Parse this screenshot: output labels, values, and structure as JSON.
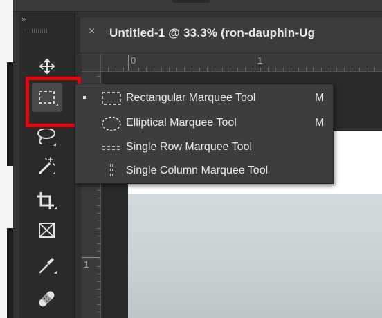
{
  "document": {
    "tab_title": "Untitled-1 @ 33.3% (ron-dauphin-Ug",
    "close_symbol": "×"
  },
  "toolbar": {
    "collapse_symbol": "››",
    "tools": [
      {
        "name": "move-tool",
        "icon": "move-icon"
      },
      {
        "name": "rectangular-marquee-tool",
        "icon": "rectangular-marquee-icon",
        "selected": true
      },
      {
        "name": "lasso-tool",
        "icon": "lasso-icon"
      },
      {
        "name": "magic-wand-tool",
        "icon": "magic-wand-icon"
      },
      {
        "name": "crop-tool",
        "icon": "crop-icon"
      },
      {
        "name": "frame-tool",
        "icon": "frame-icon"
      },
      {
        "name": "eyedropper-tool",
        "icon": "eyedropper-icon"
      },
      {
        "name": "healing-brush-tool",
        "icon": "bandage-icon"
      }
    ]
  },
  "rulers": {
    "top_labels": [
      "0",
      "1"
    ],
    "left_labels": [
      "1"
    ]
  },
  "flyout_menu": {
    "items": [
      {
        "label": "Rectangular Marquee Tool",
        "shortcut": "M",
        "icon": "rectangular-marquee-icon",
        "active": true
      },
      {
        "label": "Elliptical Marquee Tool",
        "shortcut": "M",
        "icon": "elliptical-marquee-icon",
        "active": false
      },
      {
        "label": "Single Row Marquee Tool",
        "shortcut": "",
        "icon": "single-row-marquee-icon",
        "active": false
      },
      {
        "label": "Single Column Marquee Tool",
        "shortcut": "",
        "icon": "single-column-marquee-icon",
        "active": false
      }
    ]
  },
  "colors": {
    "highlight": "#e3070e",
    "panel": "#2b2b2b",
    "menu": "#3d3d3d",
    "text": "#e8e8e8"
  }
}
